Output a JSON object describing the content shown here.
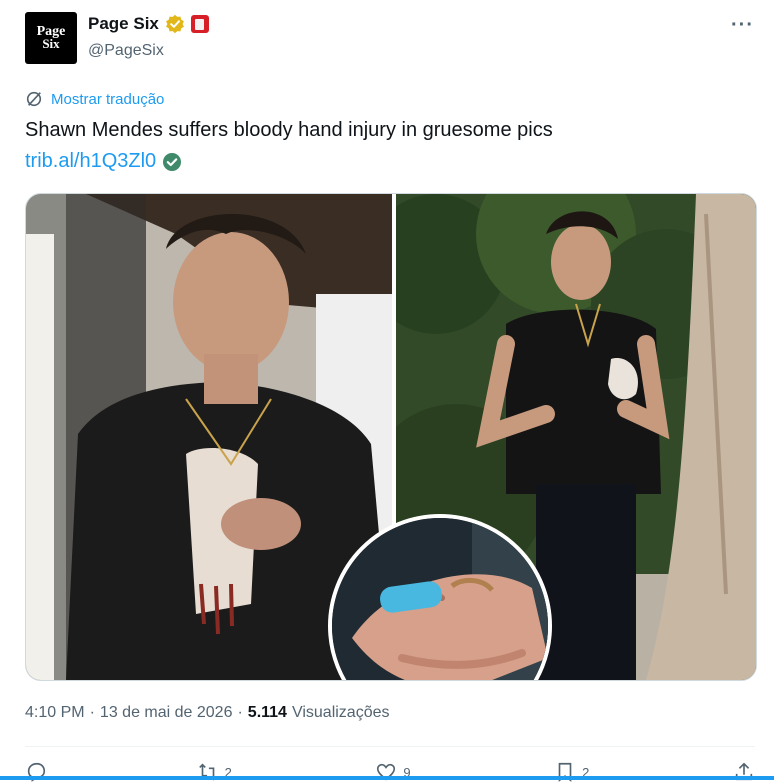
{
  "author": {
    "display_name": "Page Six",
    "handle": "@PageSix",
    "avatar_line1": "Page",
    "avatar_line2": "Six"
  },
  "translate_label": "Mostrar tradução",
  "tweet": {
    "text": "Shawn Mendes suffers bloody hand injury in gruesome pics",
    "link": "trib.al/h1Q3Zl0"
  },
  "meta": {
    "time": "4:10 PM",
    "date": "13 de mai de 2026",
    "views_count": "5.114",
    "views_label": "Visualizações"
  },
  "actions": {
    "reply": "",
    "retweet": "2",
    "like": "9",
    "bookmark": "2"
  },
  "colors": {
    "accent": "#1d9bf0",
    "text": "#0f1419",
    "muted": "#536471",
    "verified_gold": "#e2b719",
    "affiliate_red": "#d61f26"
  },
  "icons": [
    "verified-badge-icon",
    "affiliate-badge-icon",
    "more-icon",
    "translate-icon",
    "verified-check-icon",
    "reply-icon",
    "retweet-icon",
    "like-icon",
    "bookmark-icon",
    "share-icon"
  ]
}
